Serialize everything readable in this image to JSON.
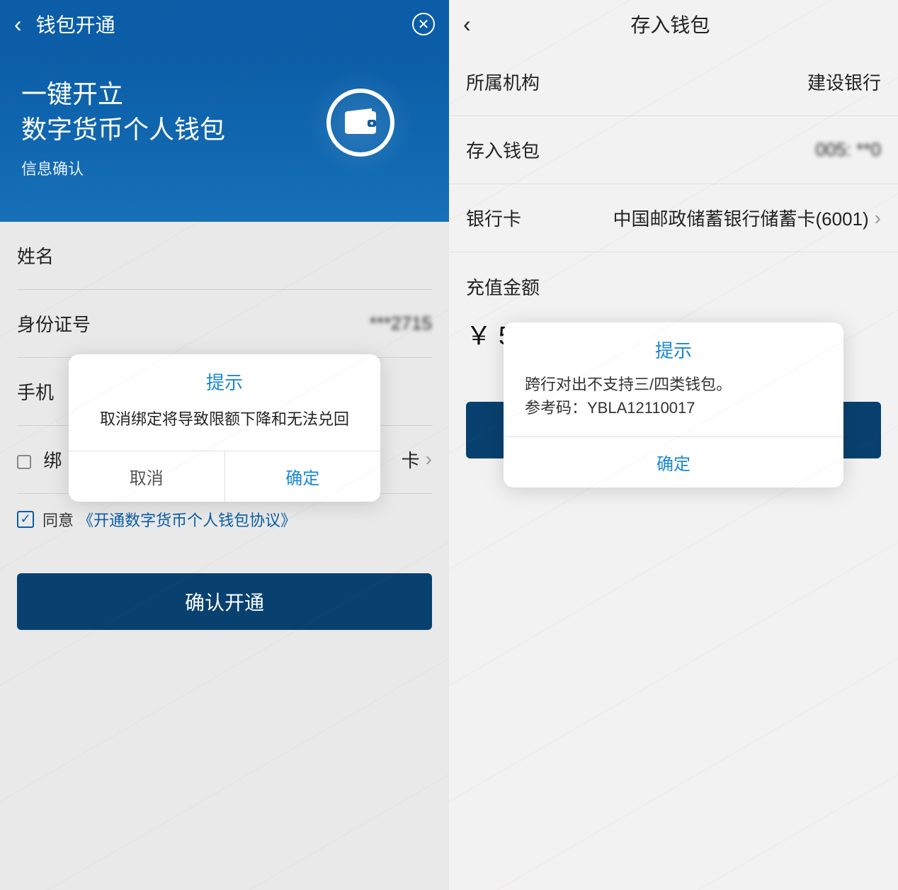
{
  "left": {
    "header_title": "钱包开通",
    "hero_line1": "一键开立",
    "hero_line2": "数字货币个人钱包",
    "hero_sub": "信息确认",
    "fields": {
      "name_label": "姓名",
      "id_label": "身份证号",
      "id_value": "***2715",
      "phone_label": "手机",
      "bind_label": "绑",
      "bind_suffix": "卡"
    },
    "agree_prefix": "同意",
    "agree_link": "《开通数字货币个人钱包协议》",
    "submit_label": "确认开通",
    "dialog": {
      "title": "提示",
      "message": "取消绑定将导致限额下降和无法兑回",
      "cancel": "取消",
      "ok": "确定"
    }
  },
  "right": {
    "header_title": "存入钱包",
    "rows": {
      "org_label": "所属机构",
      "org_value": "建设银行",
      "wallet_label": "存入钱包",
      "wallet_value": "005: **0",
      "card_label": "银行卡",
      "card_value": "中国邮政储蓄银行储蓄卡(6001)"
    },
    "amount_label": "充值金额",
    "amount_value": "￥ 5.00",
    "dialog": {
      "title": "提示",
      "message_line1": "跨行对出不支持三/四类钱包。",
      "message_line2": "参考码：YBLA12110017",
      "ok": "确定"
    }
  }
}
